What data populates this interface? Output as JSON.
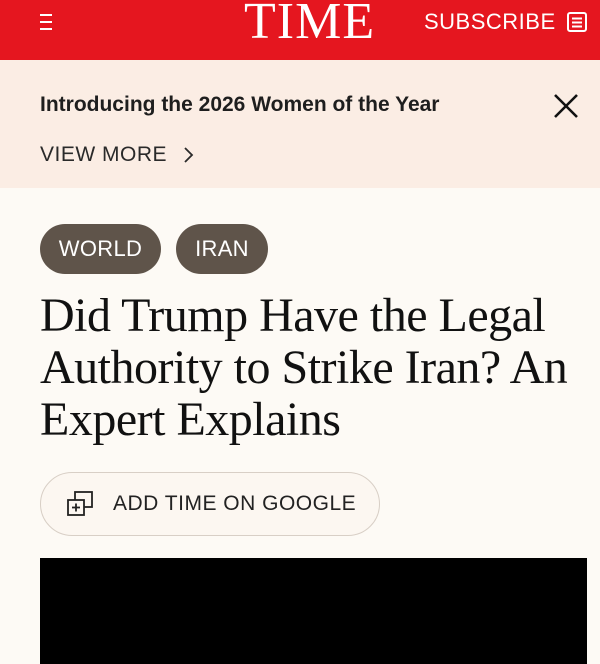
{
  "header": {
    "logo": "TIME",
    "subscribe_label": "SUBSCRIBE",
    "brand_color": "#e5161f",
    "menu_icon": "hamburger-icon",
    "subscribe_icon": "newspaper-icon"
  },
  "banner": {
    "title": "Introducing the 2026 Women of the Year",
    "view_more_label": "VIEW MORE",
    "close_icon": "close-icon",
    "background": "#fbede4"
  },
  "article": {
    "tags": [
      "WORLD",
      "IRAN"
    ],
    "headline": "Did Trump Have the Legal Authority to Strike Iran? An Expert Explains",
    "google_button_label": "ADD TIME ON GOOGLE",
    "google_button_icon": "add-source-icon"
  }
}
